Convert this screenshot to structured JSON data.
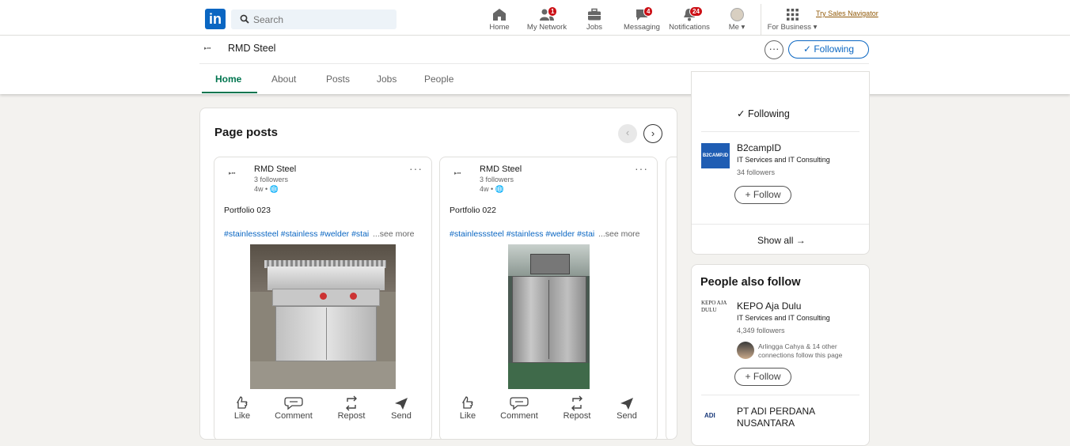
{
  "topnav": {
    "logo": "in",
    "search_placeholder": "Search",
    "items": [
      {
        "label": "Home",
        "icon": "home-icon",
        "badge": ""
      },
      {
        "label": "My Network",
        "icon": "network-icon",
        "badge": "1"
      },
      {
        "label": "Jobs",
        "icon": "briefcase-icon",
        "badge": ""
      },
      {
        "label": "Messaging",
        "icon": "message-icon",
        "badge": "4"
      },
      {
        "label": "Notifications",
        "icon": "bell-icon",
        "badge": "24"
      },
      {
        "label": "Me",
        "icon": "avatar-icon",
        "badge": ""
      },
      {
        "label": "For Business",
        "icon": "grid-icon",
        "badge": ""
      }
    ],
    "sales_navigator": "Try Sales Navigator"
  },
  "company": {
    "name": "RMD Steel",
    "logo_text": "▸▪▪",
    "more": "···",
    "following_label": "Following",
    "tabs": [
      "Home",
      "About",
      "Posts",
      "Jobs",
      "People"
    ],
    "active_tab": "Home"
  },
  "page_posts": {
    "title": "Page posts",
    "prev": "‹",
    "next": "›",
    "posts": [
      {
        "author": "RMD Steel",
        "followers": "3 followers",
        "age": "4w •",
        "title": "Portfolio 023",
        "hashtags": "#stainlesssteel #stainless #welder #stai",
        "see_more": "...see more",
        "actions": [
          "Like",
          "Comment",
          "Repost",
          "Send"
        ]
      },
      {
        "author": "RMD Steel",
        "followers": "3 followers",
        "age": "4w •",
        "title": "Portfolio 022",
        "hashtags": "#stainlesssteel #stainless #welder #stai",
        "see_more": "...see more",
        "actions": [
          "Like",
          "Comment",
          "Repost",
          "Send"
        ]
      }
    ]
  },
  "sidebar": {
    "following_label": "Following",
    "b2camp": {
      "name": "B2campID",
      "logo_text": "B2CAMP.ID",
      "industry": "IT Services and IT Consulting",
      "followers": "34 followers",
      "follow": "Follow"
    },
    "show_all": "Show all →",
    "people_also_follow": {
      "title": "People also follow",
      "items": [
        {
          "name": "KEPO Aja Dulu",
          "logo_text": "KEPO AJA DULU",
          "industry": "IT Services and IT Consulting",
          "followers": "4,349 followers",
          "connections": "Arlingga Cahya & 14 other connections follow this page",
          "follow": "Follow"
        },
        {
          "name": "PT ADI PERDANA NUSANTARA",
          "logo_text": "ADI"
        }
      ]
    }
  },
  "colors": {
    "linkedin_blue": "#0a66c2",
    "active_tab_green": "#01754f",
    "badge_red": "#cc1016",
    "background": "#f3f2ef"
  }
}
